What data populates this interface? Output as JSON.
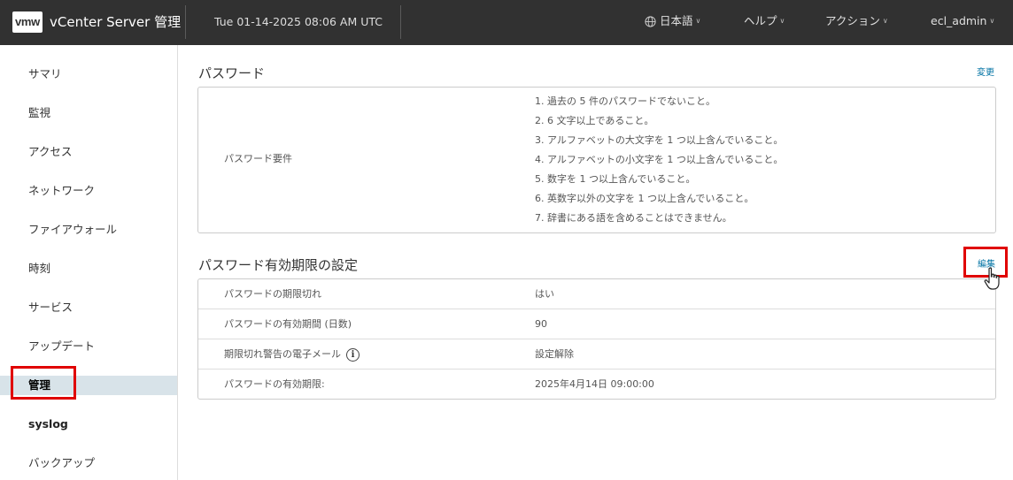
{
  "header": {
    "logo": "vmw",
    "app_title": "vCenter Server 管理",
    "datetime": "Tue 01-14-2025 08:06 AM UTC",
    "menus": {
      "language": "日本語",
      "help": "ヘルプ",
      "actions": "アクション",
      "user": "ecl_admin"
    }
  },
  "sidebar": {
    "items": [
      {
        "label": "サマリ"
      },
      {
        "label": "監視"
      },
      {
        "label": "アクセス"
      },
      {
        "label": "ネットワーク"
      },
      {
        "label": "ファイアウォール"
      },
      {
        "label": "時刻"
      },
      {
        "label": "サービス"
      },
      {
        "label": "アップデート"
      },
      {
        "label": "管理"
      },
      {
        "label": "syslog"
      },
      {
        "label": "バックアップ"
      }
    ],
    "active": "管理"
  },
  "password": {
    "title": "パスワード",
    "change_link": "変更",
    "requirements_label": "パスワード要件",
    "requirements": [
      "1. 過去の 5 件のパスワードでないこと。",
      "2. 6 文字以上であること。",
      "3. アルファベットの大文字を 1 つ以上含んでいること。",
      "4. アルファベットの小文字を 1 つ以上含んでいること。",
      "5. 数字を 1 つ以上含んでいること。",
      "6. 英数字以外の文字を 1 つ以上含んでいること。",
      "7. 辞書にある語を含めることはできません。"
    ]
  },
  "expiration": {
    "title": "パスワード有効期限の設定",
    "edit_link": "編集",
    "rows": [
      {
        "key": "パスワードの期限切れ",
        "value": "はい"
      },
      {
        "key": "パスワードの有効期間 (日数)",
        "value": "90"
      },
      {
        "key": "期限切れ警告の電子メール",
        "value": "設定解除"
      },
      {
        "key": "パスワードの有効期限:",
        "value": "2025年4月14日 09:00:00"
      }
    ]
  },
  "colors": {
    "header_bg": "#313131",
    "link": "#0072a3",
    "active_nav_bg": "#d8e3e9",
    "highlight": "#e00000"
  }
}
